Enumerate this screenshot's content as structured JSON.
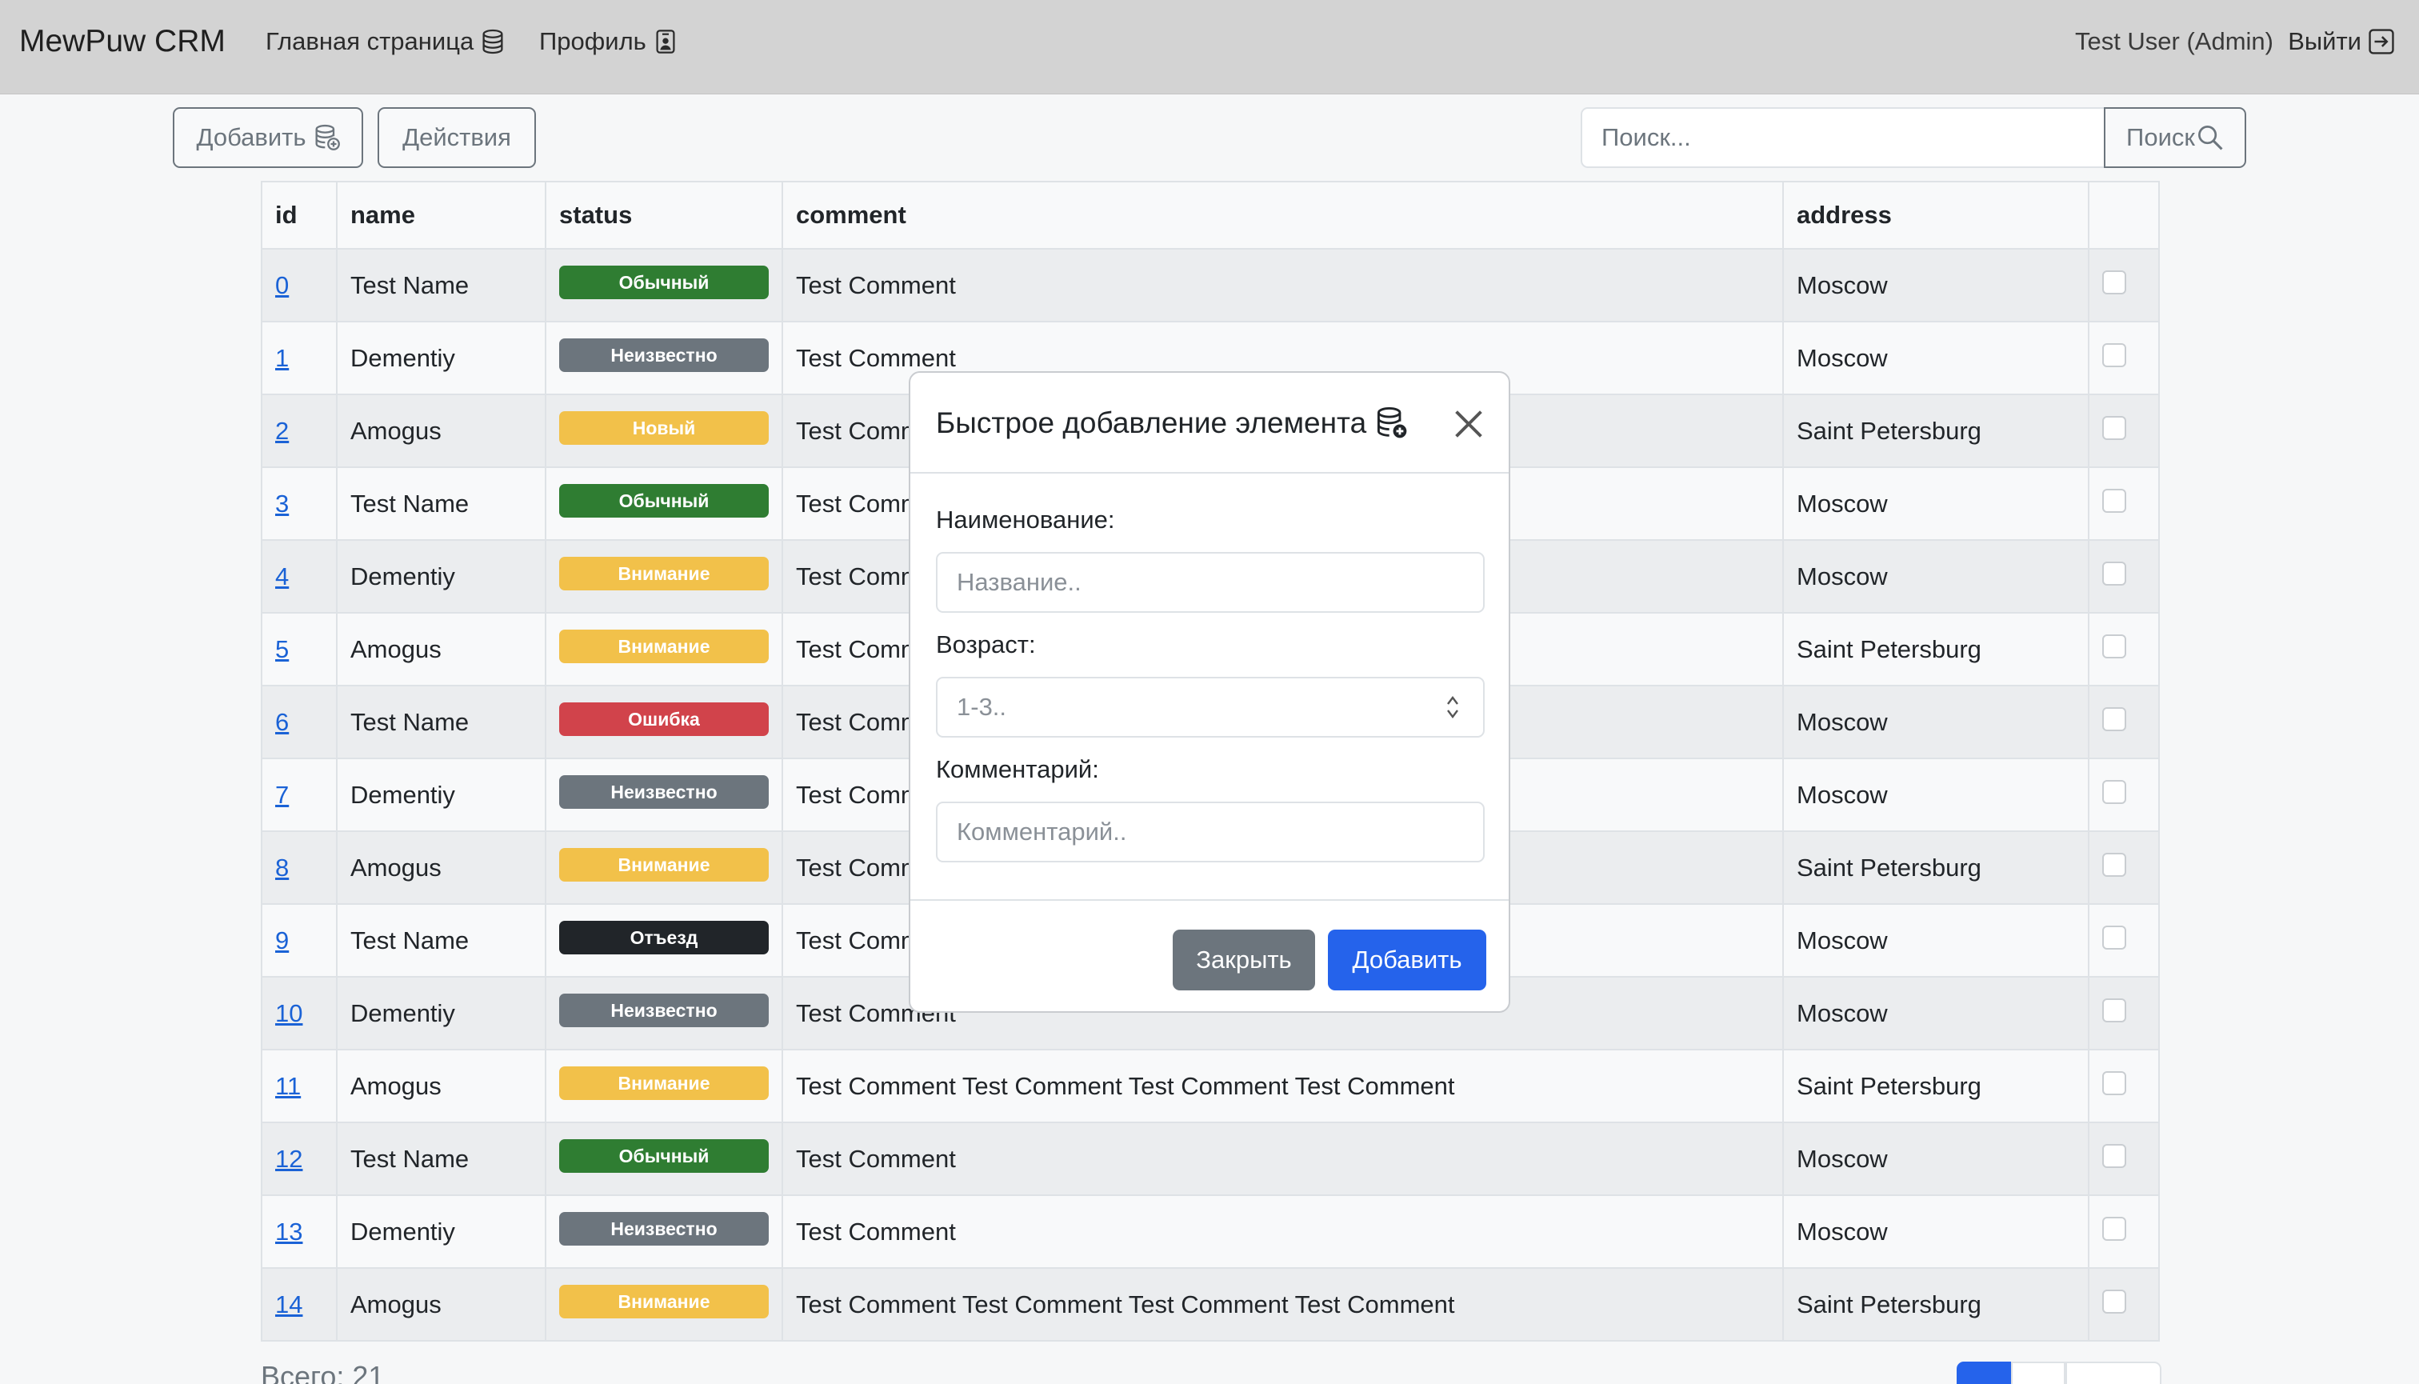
{
  "navbar": {
    "brand": "MewPuw CRM",
    "home": "Главная страница",
    "profile": "Профиль",
    "user": "Test User (Admin)",
    "logout": "Выйти"
  },
  "toolbar": {
    "add_label": "Добавить",
    "actions_label": "Действия",
    "search_placeholder": "Поиск...",
    "search_button": "Поиск"
  },
  "table": {
    "headers": [
      "id",
      "name",
      "status",
      "comment",
      "address"
    ],
    "rows": [
      {
        "id": "0",
        "name": "Test Name",
        "status": "Обычный",
        "comment": "Test Comment",
        "address": "Moscow"
      },
      {
        "id": "1",
        "name": "Dementiy",
        "status": "Неизвестно",
        "comment": "Test Comment",
        "address": "Moscow"
      },
      {
        "id": "2",
        "name": "Amogus",
        "status": "Новый",
        "comment": "Test Comment",
        "address": "Saint Petersburg"
      },
      {
        "id": "3",
        "name": "Test Name",
        "status": "Обычный",
        "comment": "Test Comment",
        "address": "Moscow"
      },
      {
        "id": "4",
        "name": "Dementiy",
        "status": "Внимание",
        "comment": "Test Comment",
        "address": "Moscow"
      },
      {
        "id": "5",
        "name": "Amogus",
        "status": "Внимание",
        "comment": "Test Comment",
        "address": "Saint Petersburg"
      },
      {
        "id": "6",
        "name": "Test Name",
        "status": "Ошибка",
        "comment": "Test Comment",
        "address": "Moscow"
      },
      {
        "id": "7",
        "name": "Dementiy",
        "status": "Неизвестно",
        "comment": "Test Comment",
        "address": "Moscow"
      },
      {
        "id": "8",
        "name": "Amogus",
        "status": "Внимание",
        "comment": "Test Comment",
        "address": "Saint Petersburg"
      },
      {
        "id": "9",
        "name": "Test Name",
        "status": "Отъезд",
        "comment": "Test Comment",
        "address": "Moscow"
      },
      {
        "id": "10",
        "name": "Dementiy",
        "status": "Неизвестно",
        "comment": "Test Comment",
        "address": "Moscow"
      },
      {
        "id": "11",
        "name": "Amogus",
        "status": "Внимание",
        "comment": "Test Comment Test Comment Test Comment Test Comment",
        "address": "Saint Petersburg"
      },
      {
        "id": "12",
        "name": "Test Name",
        "status": "Обычный",
        "comment": "Test Comment",
        "address": "Moscow"
      },
      {
        "id": "13",
        "name": "Dementiy",
        "status": "Неизвестно",
        "comment": "Test Comment",
        "address": "Moscow"
      },
      {
        "id": "14",
        "name": "Amogus",
        "status": "Внимание",
        "comment": "Test Comment Test Comment Test Comment Test Comment",
        "address": "Saint Petersburg"
      }
    ],
    "status_colors": {
      "Обычный": "#2f7d32",
      "Неизвестно": "#6c757d",
      "Новый": "#f2c14a",
      "Внимание": "#f2c14a",
      "Ошибка": "#d1434b",
      "Отъезд": "#212529"
    }
  },
  "footer": {
    "total": "Всего: 21"
  },
  "modal": {
    "title": "Быстрое добавление элемента",
    "name_label": "Наименование:",
    "name_placeholder": "Название..",
    "age_label": "Возраст:",
    "age_placeholder": "1-3..",
    "comment_label": "Комментарий:",
    "comment_placeholder": "Комментарий..",
    "close_button": "Закрыть",
    "add_button": "Добавить"
  },
  "colors": {
    "accent": "#2563eb",
    "navbar_bg": "#d3d3d3",
    "link": "#1a62d6"
  },
  "icons": [
    "database-icon",
    "user-badge-icon",
    "logout-icon",
    "database-add-icon",
    "search-icon",
    "close-icon",
    "spinner-arrows-icon"
  ]
}
